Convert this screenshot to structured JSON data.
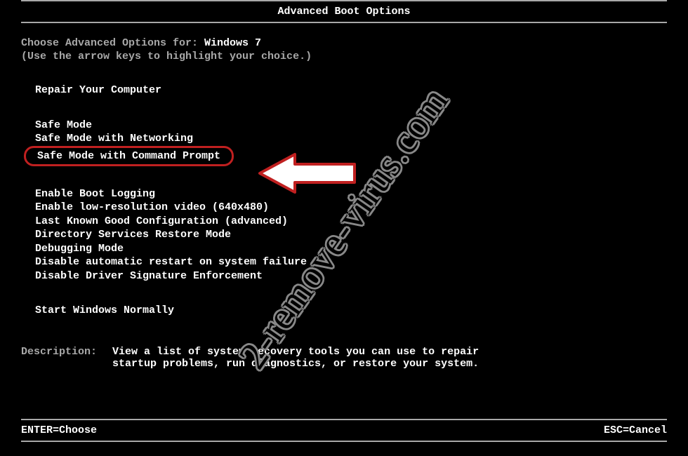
{
  "title": "Advanced Boot Options",
  "header": {
    "prefix": "Choose Advanced Options for: ",
    "os": "Windows 7",
    "instruction": "(Use the arrow keys to highlight your choice.)"
  },
  "sections": {
    "repair": "Repair Your Computer",
    "safe_modes": [
      "Safe Mode",
      "Safe Mode with Networking",
      "Safe Mode with Command Prompt"
    ],
    "options": [
      "Enable Boot Logging",
      "Enable low-resolution video (640x480)",
      "Last Known Good Configuration (advanced)",
      "Directory Services Restore Mode",
      "Debugging Mode",
      "Disable automatic restart on system failure",
      "Disable Driver Signature Enforcement"
    ],
    "normal": "Start Windows Normally"
  },
  "description": {
    "label": "Description:",
    "text_line1": "View a list of system recovery tools you can use to repair",
    "text_line2": "startup problems, run diagnostics, or restore your system."
  },
  "footer": {
    "left": "ENTER=Choose",
    "right": "ESC=Cancel"
  },
  "watermark": "2-remove-virus.com",
  "highlight_color": "#c02020"
}
